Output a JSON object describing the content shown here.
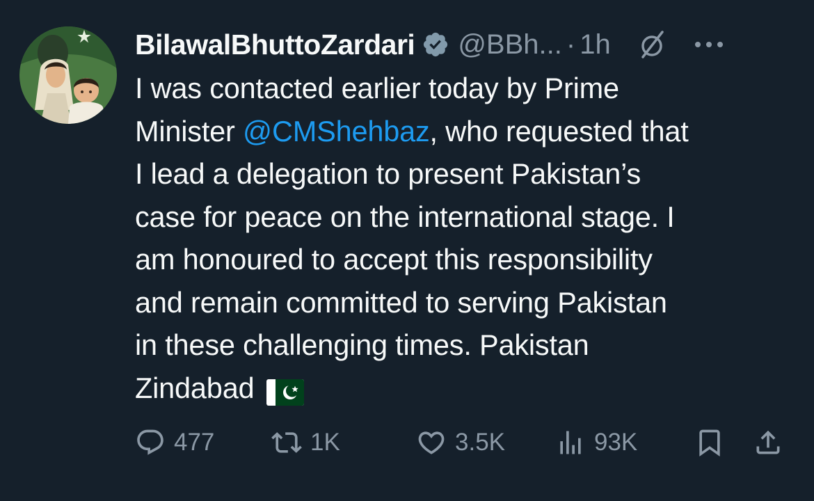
{
  "author": {
    "name": "BilawalBhuttoZardari",
    "handle": "@BBh...",
    "separator": "·",
    "time": "1h"
  },
  "tweet": {
    "lines": [
      "I was contacted earlier today by Prime",
      "Minister ",
      "I lead a delegation to present Pakistan’s",
      "case for peace on the international stage. I",
      "am honoured to accept this responsibility",
      "and remain committed to serving Pakistan",
      "in these challenging times. Pakistan",
      "Zindabad"
    ],
    "mention": "@CMShehbaz",
    "after_mention": ", who requested that",
    "flag_emoji": "pakistan-flag"
  },
  "actions": {
    "replies": "477",
    "reposts": "1K",
    "likes": "3.5K",
    "views": "93K"
  },
  "icons": {
    "verified": "verified-badge-icon",
    "grok": "grok-icon",
    "more": "more-icon",
    "reply": "reply-icon",
    "repost": "repost-icon",
    "like": "like-icon",
    "views": "views-icon",
    "bookmark": "bookmark-icon",
    "share": "share-icon"
  },
  "colors": {
    "background": "#15202b",
    "text": "#f7f9f9",
    "muted": "#8b98a5",
    "link": "#1d9bf0",
    "flag_green": "#01411c"
  }
}
